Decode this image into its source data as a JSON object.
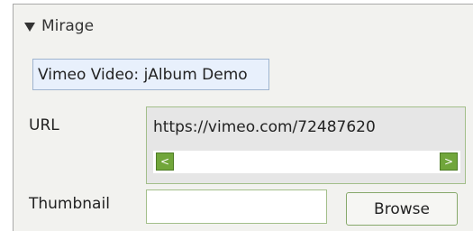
{
  "section": {
    "title": "Mirage",
    "expanded": true
  },
  "item": {
    "title": "Vimeo Video: jAlbum Demo"
  },
  "url": {
    "label": "URL",
    "value": "https://vimeo.com/72487620",
    "scroll_left_glyph": "<",
    "scroll_right_glyph": ">"
  },
  "thumbnail": {
    "label": "Thumbnail",
    "value": "",
    "browse_label": "Browse"
  },
  "colors": {
    "panel_bg": "#f2f2ef",
    "field_border": "#a3bf8a",
    "scroll_button": "#71a63b",
    "title_pill_bg": "#e8f0fc"
  }
}
